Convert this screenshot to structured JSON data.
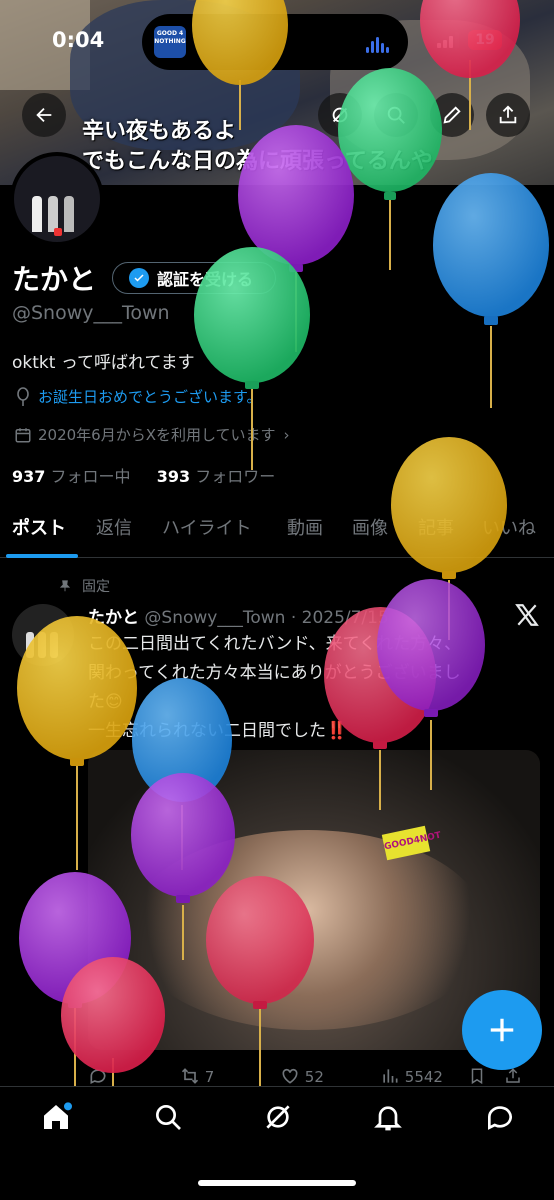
{
  "status_bar": {
    "time": "0:04",
    "battery": "19",
    "now_playing_art": "GOOD 4 NOTHING"
  },
  "banner": {
    "caption_line1": "辛い夜もあるよ",
    "caption_line2": "でもこんな日の為に頑張ってるんや"
  },
  "profile": {
    "name": "たかと",
    "verify_button": "認証を受ける",
    "handle": "@Snowy___Town",
    "bio": "oktkt って呼ばれてます",
    "birthday": "お誕生日おめでとうございます。",
    "joined": "2020年6月からXを利用しています",
    "following_count": "937",
    "following_label": "フォロー中",
    "followers_count": "393",
    "followers_label": "フォロワー"
  },
  "tabs": [
    "ポスト",
    "返信",
    "ハイライト",
    "動画",
    "画像",
    "記事",
    "いいね"
  ],
  "post": {
    "pinned_label": "固定",
    "author": "たかと",
    "handle_date": "@Snowy___Town · 2025/7/15",
    "text_lines": [
      "この二日間出てくれたバンド、来てくれた方々、",
      "関わってくれた方々本当にありがとうございまし",
      "た😊",
      "一生忘れられない二日間でした‼️"
    ],
    "photo_sign": "GOOD4NOT",
    "reposts": "7",
    "likes": "52",
    "views": "5542"
  },
  "colors": {
    "accent": "#1d9bf0",
    "background": "#000000",
    "muted": "#71767b",
    "balloon_purple": "#9b2fd6",
    "balloon_green": "#2ecc7a",
    "balloon_blue": "#2b8fe0",
    "balloon_yellow": "#e8b21c",
    "balloon_pink": "#e8335a"
  },
  "icons": {
    "back": "arrow-left-icon",
    "grok": "grok-icon",
    "search": "search-icon",
    "edit": "pencil-icon",
    "share": "share-icon",
    "birthday": "balloon-icon",
    "calendar": "calendar-icon",
    "pin": "pin-icon",
    "compose": "plus-icon"
  }
}
